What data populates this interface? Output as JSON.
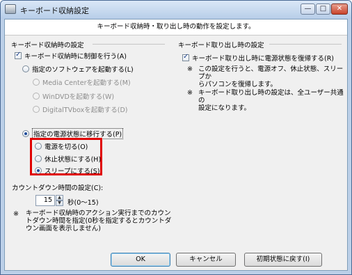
{
  "window": {
    "title": "キーボード収納設定",
    "controls": {
      "minimize": "—",
      "maximize": "□",
      "close": "✕"
    }
  },
  "header": {
    "text": "キーボード収納時・取り出し時の動作を設定します。"
  },
  "storage": {
    "group_label": "キーボード収納時の設定",
    "control_checkbox": {
      "label": "キーボード収納時に制御を行う(A)",
      "checked": true
    },
    "software_radio": {
      "label": "指定のソフトウェアを起動する(L)",
      "selected": false
    },
    "software_options": [
      {
        "label": "Media Centerを起動する(M)",
        "enabled": false
      },
      {
        "label": "WinDVDを起動する(W)",
        "enabled": false
      },
      {
        "label": "DigitalTVboxを起動する(D)",
        "enabled": false
      }
    ],
    "power_radio": {
      "label": "指定の電源状態に移行する(P)",
      "selected": true
    },
    "power_options": [
      {
        "label": "電源を切る(O)",
        "selected": false
      },
      {
        "label": "休止状態にする(H)",
        "selected": false
      },
      {
        "label": "スリープにする(S)",
        "selected": true
      }
    ]
  },
  "countdown": {
    "label": "カウントダウン時間の設定(C):",
    "value": "15",
    "unit": "秒(0〜15)",
    "note_mark": "※",
    "note_lines": [
      "キーボード収納時のアクション実行までのカウン",
      "トダウン時間を指定(0秒を指定するとカウントダ",
      "ウン画面を表示しません)"
    ]
  },
  "removal": {
    "group_label": "キーボード取り出し時の設定",
    "restore_checkbox": {
      "label": "キーボード取り出し時に電源状態を復帰する(R)",
      "checked": true
    },
    "notes": [
      {
        "mark": "※",
        "lines": [
          "この設定を行うと、電源オフ、休止状態、スリープか",
          "らパソコンを復帰します。"
        ]
      },
      {
        "mark": "※",
        "lines": [
          "キーボード取り出し時の設定は、全ユーザー共通の",
          "設定になります。"
        ]
      }
    ]
  },
  "buttons": {
    "ok": "OK",
    "cancel": "キャンセル",
    "reset": "初期状態に戻す(I)"
  },
  "colors": {
    "highlight_box": "#e00000",
    "title_bar": "#c9d9ef"
  }
}
